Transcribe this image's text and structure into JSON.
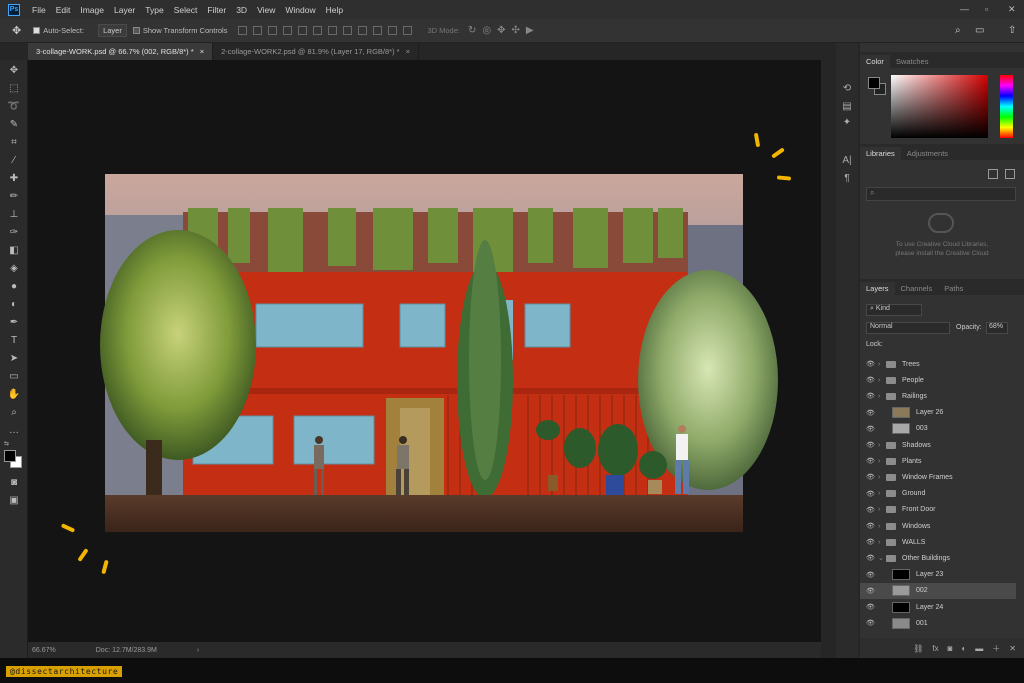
{
  "app": {
    "logo": "Ps"
  },
  "menu": [
    "File",
    "Edit",
    "Image",
    "Layer",
    "Type",
    "Select",
    "Filter",
    "3D",
    "View",
    "Window",
    "Help"
  ],
  "options": {
    "auto_select_label": "Auto-Select:",
    "auto_select_value": "Layer",
    "transform_label": "Show Transform Controls",
    "mode_3d": "3D Mode:"
  },
  "tabs": [
    {
      "label": "3-collage-WORK.psd @ 66.7% (002, RGB/8*) *",
      "active": true
    },
    {
      "label": "2-collage-WORK2.psd @ 81.9% (Layer 17, RGB/8*) *",
      "active": false
    }
  ],
  "status": {
    "zoom": "66.67%",
    "doc": "Doc: 12.7M/283.9M"
  },
  "color_panel": {
    "tabs": [
      "Color",
      "Swatches"
    ]
  },
  "libraries_panel": {
    "tabs": [
      "Libraries",
      "Adjustments"
    ],
    "message_line1": "To use Creative Cloud Libraries,",
    "message_line2": "please install the Creative Cloud"
  },
  "layers_panel": {
    "tabs": [
      "Layers",
      "Channels",
      "Paths"
    ],
    "filter_kind": "Kind",
    "blend_mode": "Normal",
    "opacity_label": "Opacity:",
    "opacity_value": "68%",
    "lock_label": "Lock:",
    "layers": [
      {
        "name": "Trees",
        "kind": "group"
      },
      {
        "name": "People",
        "kind": "group"
      },
      {
        "name": "Railings",
        "kind": "group"
      },
      {
        "name": "Layer 26",
        "kind": "layer",
        "thumb": "#8a7a5a"
      },
      {
        "name": "003",
        "kind": "layer",
        "thumb": "#a8a8a8"
      },
      {
        "name": "Shadows",
        "kind": "group"
      },
      {
        "name": "Plants",
        "kind": "group"
      },
      {
        "name": "Window Frames",
        "kind": "group"
      },
      {
        "name": "Ground",
        "kind": "group"
      },
      {
        "name": "Front Door",
        "kind": "group"
      },
      {
        "name": "Windows",
        "kind": "group"
      },
      {
        "name": "WALLS",
        "kind": "group"
      },
      {
        "name": "Other Buildings",
        "kind": "group-open"
      },
      {
        "name": "Layer 23",
        "kind": "layer",
        "thumb": "#000000"
      },
      {
        "name": "002",
        "kind": "layer",
        "thumb": "#9a9a9a",
        "selected": true
      },
      {
        "name": "Layer 24",
        "kind": "layer",
        "thumb": "#000000"
      },
      {
        "name": "001",
        "kind": "layer",
        "thumb": "#8a8a8a"
      }
    ]
  },
  "overlay": {
    "watermark": "@dissectarchitecture"
  },
  "colors": {
    "accent": "#f2b600",
    "wall": "#c42e12",
    "panel_bg": "#323232"
  }
}
